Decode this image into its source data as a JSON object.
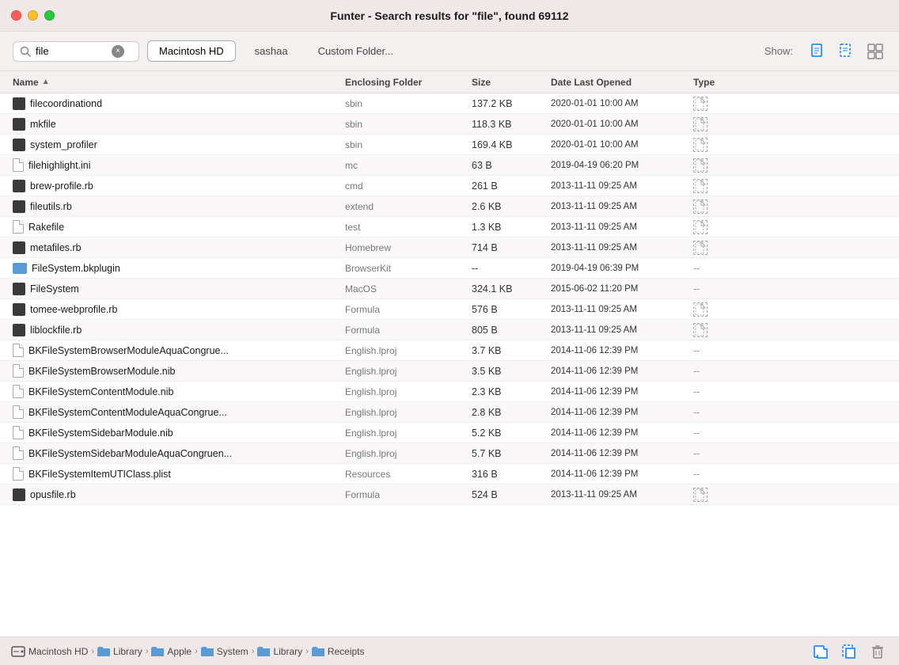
{
  "titleBar": {
    "title": "Funter - Search results for \"file\", found 69112"
  },
  "toolbar": {
    "searchPlaceholder": "file",
    "searchValue": "file",
    "clearButton": "×",
    "tabs": [
      {
        "label": "Macintosh HD",
        "active": true
      },
      {
        "label": "sashaa",
        "active": false
      },
      {
        "label": "Custom Folder...",
        "active": false
      }
    ],
    "showLabel": "Show:"
  },
  "table": {
    "columns": [
      "Name",
      "Enclosing Folder",
      "Size",
      "Date Last Opened",
      "Type"
    ],
    "rows": [
      {
        "name": "filecoordinationd",
        "icon": "dark",
        "folder": "sbin",
        "size": "137.2 KB",
        "date": "2020-01-01 10:00 AM",
        "type": "icon"
      },
      {
        "name": "mkfile",
        "icon": "dark",
        "folder": "sbin",
        "size": "118.3 KB",
        "date": "2020-01-01 10:00 AM",
        "type": "icon"
      },
      {
        "name": "system_profiler",
        "icon": "dark",
        "folder": "sbin",
        "size": "169.4 KB",
        "date": "2020-01-01 10:00 AM",
        "type": "icon"
      },
      {
        "name": "filehighlight.ini",
        "icon": "doc",
        "folder": "mc",
        "size": "63 B",
        "date": "2019-04-19 06:20 PM",
        "type": "icon"
      },
      {
        "name": "brew-profile.rb",
        "icon": "dark",
        "folder": "cmd",
        "size": "261 B",
        "date": "2013-11-11 09:25 AM",
        "type": "icon"
      },
      {
        "name": "fileutils.rb",
        "icon": "dark",
        "folder": "extend",
        "size": "2.6 KB",
        "date": "2013-11-11 09:25 AM",
        "type": "icon"
      },
      {
        "name": "Rakefile",
        "icon": "doc",
        "folder": "test",
        "size": "1.3 KB",
        "date": "2013-11-11 09:25 AM",
        "type": "icon"
      },
      {
        "name": "metafiles.rb",
        "icon": "dark",
        "folder": "Homebrew",
        "size": "714 B",
        "date": "2013-11-11 09:25 AM",
        "type": "icon"
      },
      {
        "name": "FileSystem.bkplugin",
        "icon": "folder",
        "folder": "BrowserKit",
        "size": "--",
        "date": "2019-04-19 06:39 PM",
        "type": "dash"
      },
      {
        "name": "FileSystem",
        "icon": "dark",
        "folder": "MacOS",
        "size": "324.1 KB",
        "date": "2015-06-02 11:20 PM",
        "type": "dash"
      },
      {
        "name": "tomee-webprofile.rb",
        "icon": "dark",
        "folder": "Formula",
        "size": "576 B",
        "date": "2013-11-11 09:25 AM",
        "type": "icon"
      },
      {
        "name": "liblockfile.rb",
        "icon": "dark",
        "folder": "Formula",
        "size": "805 B",
        "date": "2013-11-11 09:25 AM",
        "type": "icon"
      },
      {
        "name": "BKFileSystemBrowserModuleAquaCongrue...",
        "icon": "doc",
        "folder": "English.lproj",
        "size": "3.7 KB",
        "date": "2014-11-06 12:39 PM",
        "type": "dash"
      },
      {
        "name": "BKFileSystemBrowserModule.nib",
        "icon": "doc",
        "folder": "English.lproj",
        "size": "3.5 KB",
        "date": "2014-11-06 12:39 PM",
        "type": "dash"
      },
      {
        "name": "BKFileSystemContentModule.nib",
        "icon": "doc",
        "folder": "English.lproj",
        "size": "2.3 KB",
        "date": "2014-11-06 12:39 PM",
        "type": "dash"
      },
      {
        "name": "BKFileSystemContentModuleAquaCongrue...",
        "icon": "doc",
        "folder": "English.lproj",
        "size": "2.8 KB",
        "date": "2014-11-06 12:39 PM",
        "type": "dash"
      },
      {
        "name": "BKFileSystemSidebarModule.nib",
        "icon": "doc",
        "folder": "English.lproj",
        "size": "5.2 KB",
        "date": "2014-11-06 12:39 PM",
        "type": "dash"
      },
      {
        "name": "BKFileSystemSidebarModuleAquaCongruen...",
        "icon": "doc",
        "folder": "English.lproj",
        "size": "5.7 KB",
        "date": "2014-11-06 12:39 PM",
        "type": "dash"
      },
      {
        "name": "BKFileSystemItemUTIClass.plist",
        "icon": "doc",
        "folder": "Resources",
        "size": "316 B",
        "date": "2014-11-06 12:39 PM",
        "type": "dash"
      },
      {
        "name": "opusfile.rb",
        "icon": "dark",
        "folder": "Formula",
        "size": "524 B",
        "date": "2013-11-11 09:25 AM",
        "type": "icon"
      }
    ]
  },
  "statusBar": {
    "breadcrumb": [
      "Macintosh HD",
      "Library",
      "Apple",
      "System",
      "Library",
      "Receipts"
    ]
  }
}
